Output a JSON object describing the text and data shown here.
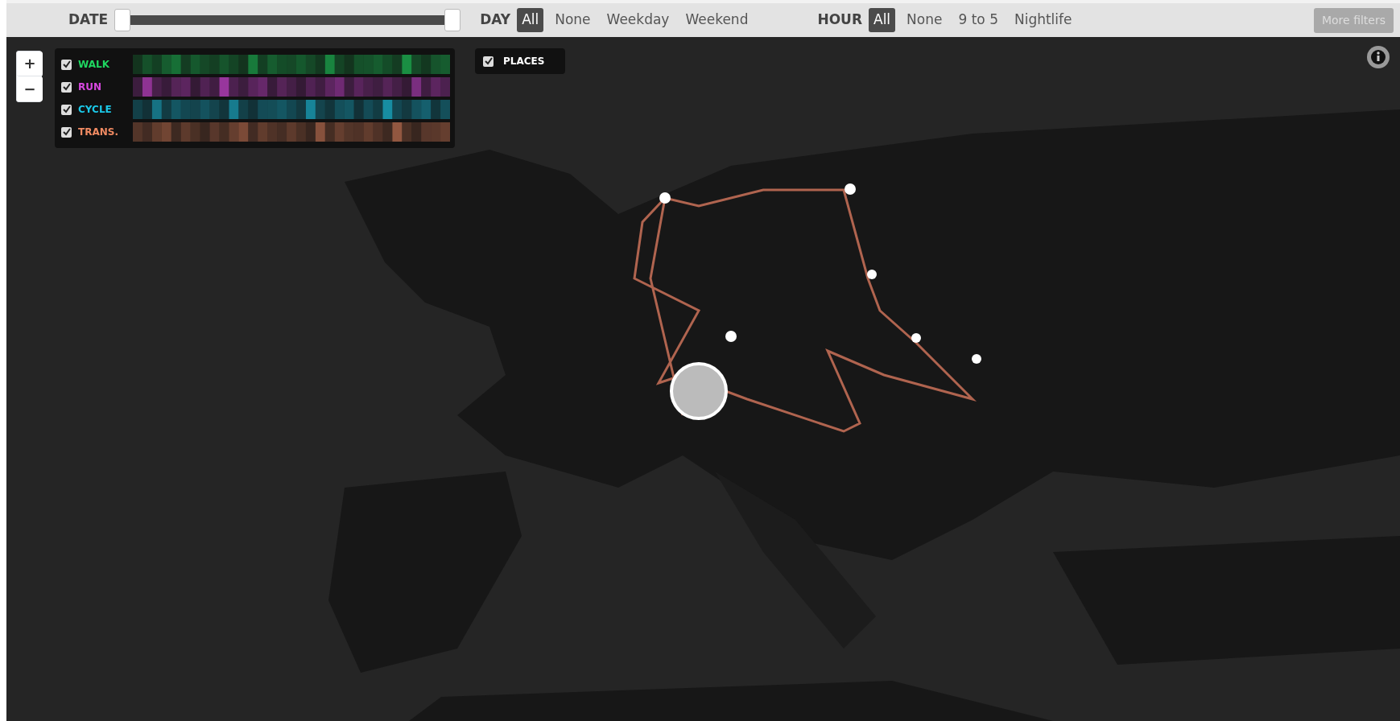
{
  "filters": {
    "date": {
      "label": "DATE",
      "handles": [
        {
          "level": 0
        },
        {
          "level": 1
        }
      ]
    },
    "groups": [
      {
        "label": "DAY",
        "options": [
          {
            "label": "All",
            "selected": true
          },
          {
            "label": "None",
            "selected": false
          },
          {
            "label": "Weekday",
            "selected": false
          },
          {
            "label": "Weekend",
            "selected": false
          }
        ]
      },
      {
        "label": "HOUR",
        "options": [
          {
            "label": "All",
            "selected": true
          },
          {
            "label": "None",
            "selected": false
          },
          {
            "label": "9 to 5",
            "selected": false
          },
          {
            "label": "Nightlife",
            "selected": false
          }
        ]
      }
    ],
    "more_button": {
      "label": "More filters",
      "disabled": true
    }
  },
  "map": {
    "zoom_in": "+",
    "zoom_out": "−",
    "layers": [
      {
        "label": "WALK",
        "checked": true,
        "color": "#1fd760"
      },
      {
        "label": "RUN",
        "checked": true,
        "color": "#d848e0"
      },
      {
        "label": "CYCLE",
        "checked": true,
        "color": "#1bc8e8"
      },
      {
        "label": "TRANS.",
        "checked": true,
        "color": "#f08a62"
      }
    ],
    "places": {
      "label": "PLACES",
      "checked": true
    }
  }
}
